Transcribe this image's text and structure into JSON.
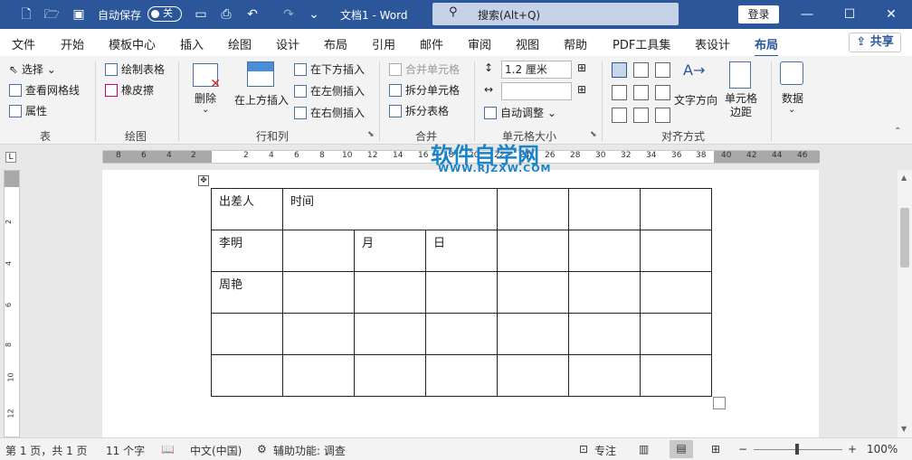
{
  "titlebar": {
    "autosave_label": "自动保存",
    "autosave_state": "关",
    "doc_title": "文档1  -  Word",
    "search_placeholder": "搜索(Alt+Q)",
    "login": "登录"
  },
  "menu": {
    "tabs": [
      "文件",
      "开始",
      "模板中心",
      "插入",
      "绘图",
      "设计",
      "布局",
      "引用",
      "邮件",
      "审阅",
      "视图",
      "帮助",
      "PDF工具集",
      "表设计",
      "布局"
    ],
    "share": "共享"
  },
  "ribbon": {
    "table_group": {
      "select": "选择",
      "gridlines": "查看网格线",
      "properties": "属性",
      "label": "表"
    },
    "draw_group": {
      "draw_table": "绘制表格",
      "eraser": "橡皮擦",
      "label": "绘图"
    },
    "rows_group": {
      "delete": "删除",
      "insert_above": "在上方插入",
      "insert_below": "在下方插入",
      "insert_left": "在左侧插入",
      "insert_right": "在右侧插入",
      "label": "行和列"
    },
    "merge_group": {
      "merge_cells": "合并单元格",
      "split_cells": "拆分单元格",
      "split_table": "拆分表格",
      "label": "合并"
    },
    "cellsize_group": {
      "height_value": "1.2 厘米",
      "width_value": "",
      "autofit": "自动调整",
      "label": "单元格大小"
    },
    "align_group": {
      "text_direction": "文字方向",
      "cell_margins": "单元格\n边距",
      "label": "对齐方式"
    },
    "data_group": {
      "data": "数据"
    }
  },
  "ruler": {
    "left": [
      "8",
      "6",
      "4",
      "2"
    ],
    "right": [
      "2",
      "4",
      "6",
      "8",
      "10",
      "12",
      "14",
      "16",
      "18",
      "20",
      "22",
      "24",
      "26",
      "28",
      "30",
      "32",
      "34",
      "36",
      "38",
      "40",
      "42",
      "44",
      "46"
    ],
    "vertical": [
      "2",
      "4",
      "6",
      "8",
      "10",
      "12"
    ]
  },
  "table": [
    [
      "出差人",
      "时间",
      "",
      "",
      "",
      "",
      ""
    ],
    [
      "李明",
      "",
      "月",
      "日",
      "",
      "",
      ""
    ],
    [
      "周艳",
      "",
      "",
      "",
      "",
      "",
      ""
    ],
    [
      "",
      "",
      "",
      "",
      "",
      "",
      ""
    ],
    [
      "",
      "",
      "",
      "",
      "",
      "",
      ""
    ]
  ],
  "status": {
    "page": "第 1 页，共 1 页",
    "words": "11 个字",
    "lang": "中文(中国)",
    "access": "辅助功能: 调查",
    "focus": "专注",
    "zoom": "100%"
  },
  "watermark": {
    "text": "软件自学网",
    "url": "WWW.RJZXW.COM"
  }
}
